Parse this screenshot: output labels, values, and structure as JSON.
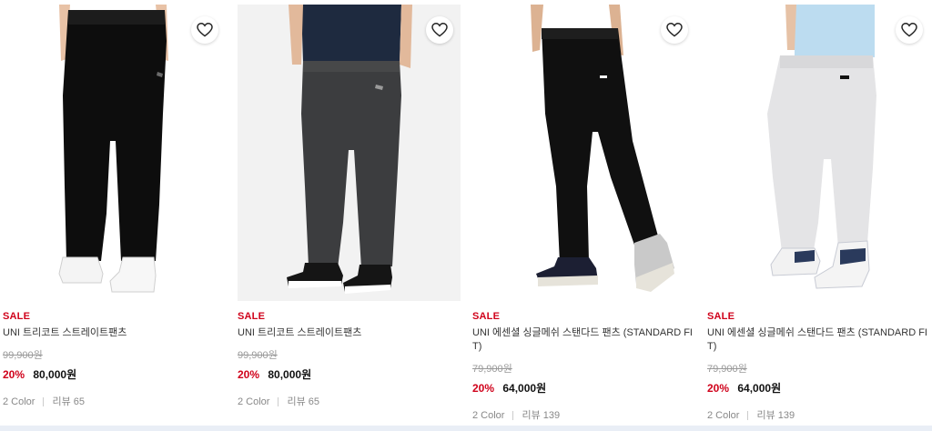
{
  "products": [
    {
      "sale_label": "SALE",
      "name": "UNI 트리코트 스트레이트팬츠",
      "original_price": "99,900원",
      "discount": "20%",
      "price": "80,000원",
      "colors": "2 Color",
      "reviews": "리뷰 65",
      "image": "black-straight-pants-white-sneakers",
      "pants_color": "#0d0d0d",
      "bg_color": "#ffffff",
      "wishlist_icon": "heart-outline-icon"
    },
    {
      "sale_label": "SALE",
      "name": "UNI 트리코트 스트레이트팬츠",
      "original_price": "99,900원",
      "discount": "20%",
      "price": "80,000원",
      "colors": "2 Color",
      "reviews": "리뷰 65",
      "image": "charcoal-straight-pants-black-sneakers",
      "pants_color": "#3c3d3f",
      "bg_color": "#f2f2f2",
      "wishlist_icon": "heart-outline-icon"
    },
    {
      "sale_label": "SALE",
      "name": "UNI 에센셜 싱글메쉬 스탠다드 팬츠 (STANDARD FIT)",
      "original_price": "79,900원",
      "discount": "20%",
      "price": "64,000원",
      "colors": "2 Color",
      "reviews": "리뷰 139",
      "image": "black-standard-pants-grey-sneakers",
      "pants_color": "#101010",
      "bg_color": "#ffffff",
      "wishlist_icon": "heart-outline-icon"
    },
    {
      "sale_label": "SALE",
      "name": "UNI 에센셜 싱글메쉬 스탠다드 팬츠 (STANDARD FIT)",
      "original_price": "79,900원",
      "discount": "20%",
      "price": "64,000원",
      "colors": "2 Color",
      "reviews": "리뷰 139",
      "image": "light-grey-standard-pants-white-sneakers",
      "pants_color": "#e4e4e6",
      "bg_color": "#ffffff",
      "wishlist_icon": "heart-outline-icon"
    }
  ],
  "theme": {
    "sale_color": "#d0021b",
    "muted_color": "#999999"
  }
}
